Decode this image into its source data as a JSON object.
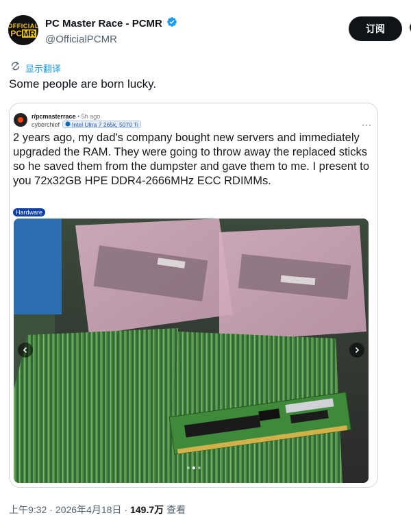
{
  "header": {
    "avatar_top": "OFFICIAL",
    "avatar_pc": "PC",
    "avatar_mr": "MR",
    "display_name": "PC Master Race - PCMR",
    "handle": "@OfficialPCMR",
    "subscribe_label": "订阅",
    "verified_color": "#1d9bf0"
  },
  "translate": {
    "label": "显示翻译",
    "icon": "translate-icon"
  },
  "tweet": {
    "text": "Some people are born lucky."
  },
  "embedded_post": {
    "subreddit": "r/pcmasterrace",
    "dot": "•",
    "time": "5h ago",
    "username": "cyberchief",
    "user_flair": "Intel Ultra 7 265k, 5070 Ti",
    "more": "···",
    "title": "2 years ago, my dad's company bought new servers and immediately upgraded the RAM. They were going to throw away the replaced sticks so he saved them from the dumpster and gave them to me. I present to you 72x32GB HPE DDR4-2666MHz ECC RDIMMs.",
    "post_flair": "Hardware",
    "image_dots": 3,
    "active_dot": 1
  },
  "meta": {
    "time": "上午9:32",
    "sep1": "·",
    "date": "2026年4月18日",
    "sep2": "·",
    "views": "149.7万",
    "views_label": "查看"
  }
}
